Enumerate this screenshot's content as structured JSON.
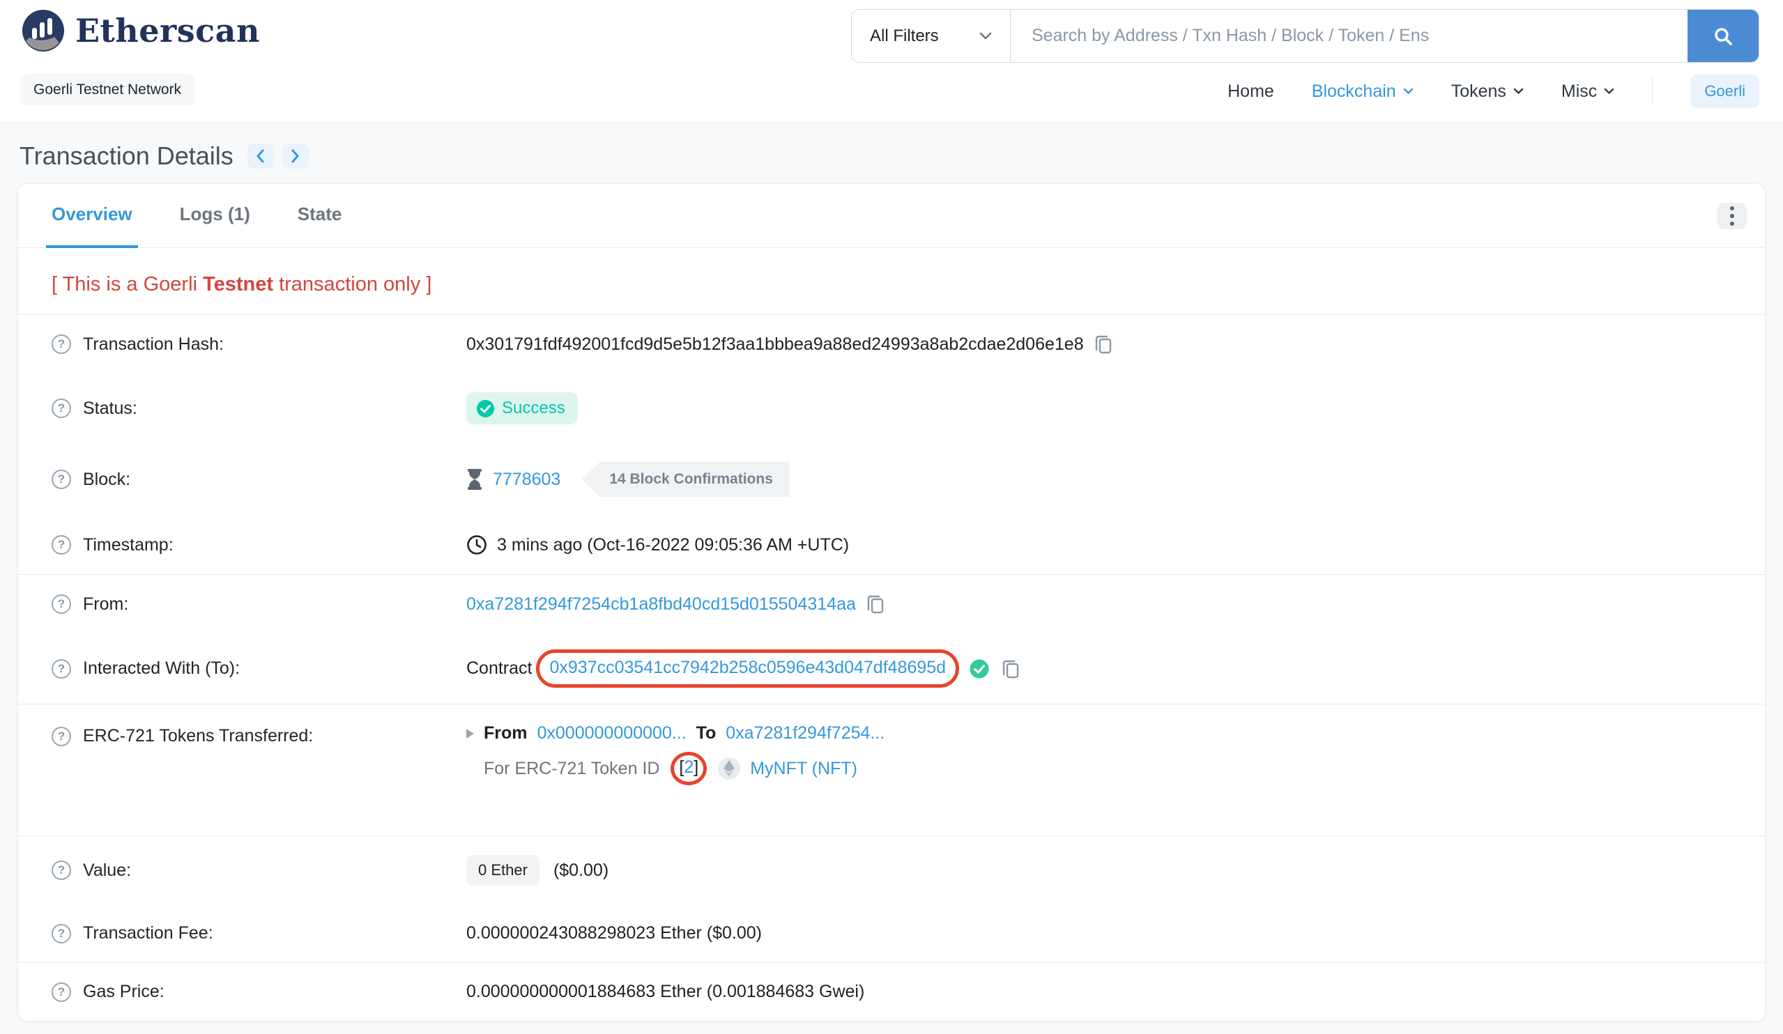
{
  "icons": {
    "question": "?"
  },
  "header": {
    "brand": "Etherscan",
    "network_badge": "Goerli Testnet Network",
    "search": {
      "filter_label": "All Filters",
      "placeholder": "Search by Address / Txn Hash / Block / Token / Ens"
    },
    "nav": {
      "items": [
        "Home",
        "Blockchain",
        "Tokens",
        "Misc"
      ],
      "network_button": "Goerli"
    }
  },
  "page": {
    "title": "Transaction Details",
    "tabs": [
      {
        "label": "Overview"
      },
      {
        "label": "Logs (1)"
      },
      {
        "label": "State"
      }
    ],
    "notice": {
      "prefix": "[ This is a Goerli ",
      "bold": "Testnet",
      "suffix": " transaction only ]"
    }
  },
  "rows": {
    "transaction_hash": {
      "label": "Transaction Hash:",
      "value": "0x301791fdf492001fcd9d5e5b12f3aa1bbbea9a88ed24993a8ab2cdae2d06e1e8"
    },
    "status": {
      "label": "Status:",
      "value": "Success"
    },
    "block": {
      "label": "Block:",
      "value": "7778603",
      "confirmations": "14 Block Confirmations"
    },
    "timestamp": {
      "label": "Timestamp:",
      "value": "3 mins ago (Oct-16-2022 09:05:36 AM +UTC)"
    },
    "from": {
      "label": "From:",
      "value": "0xa7281f294f7254cb1a8fbd40cd15d015504314aa"
    },
    "interacted_with": {
      "label": "Interacted With (To):",
      "prefix": "Contract",
      "value": "0x937cc03541cc7942b258c0596e43d047df48695d"
    },
    "erc721": {
      "label": "ERC-721 Tokens Transferred:",
      "from_label": "From",
      "from_value": "0x000000000000...",
      "to_label": "To",
      "to_value": "0xa7281f294f7254...",
      "line2_label": "For ERC-721 Token ID",
      "bracket_open": "[",
      "token_id": "2",
      "bracket_close": "]",
      "token_name": "MyNFT (NFT)"
    },
    "value": {
      "label": "Value:",
      "badge": "0 Ether",
      "usd": "($0.00)"
    },
    "fee": {
      "label": "Transaction Fee:",
      "value": "0.000000243088298023 Ether ($0.00)"
    },
    "gas_price": {
      "label": "Gas Price:",
      "value": "0.000000000001884683 Ether (0.001884683 Gwei)"
    }
  },
  "colors": {
    "brand_navy": "#21325b",
    "link_blue": "#3498db",
    "success_green": "#00c9a7",
    "notice_red": "#d2473d",
    "annotation_red": "#e8432c"
  }
}
